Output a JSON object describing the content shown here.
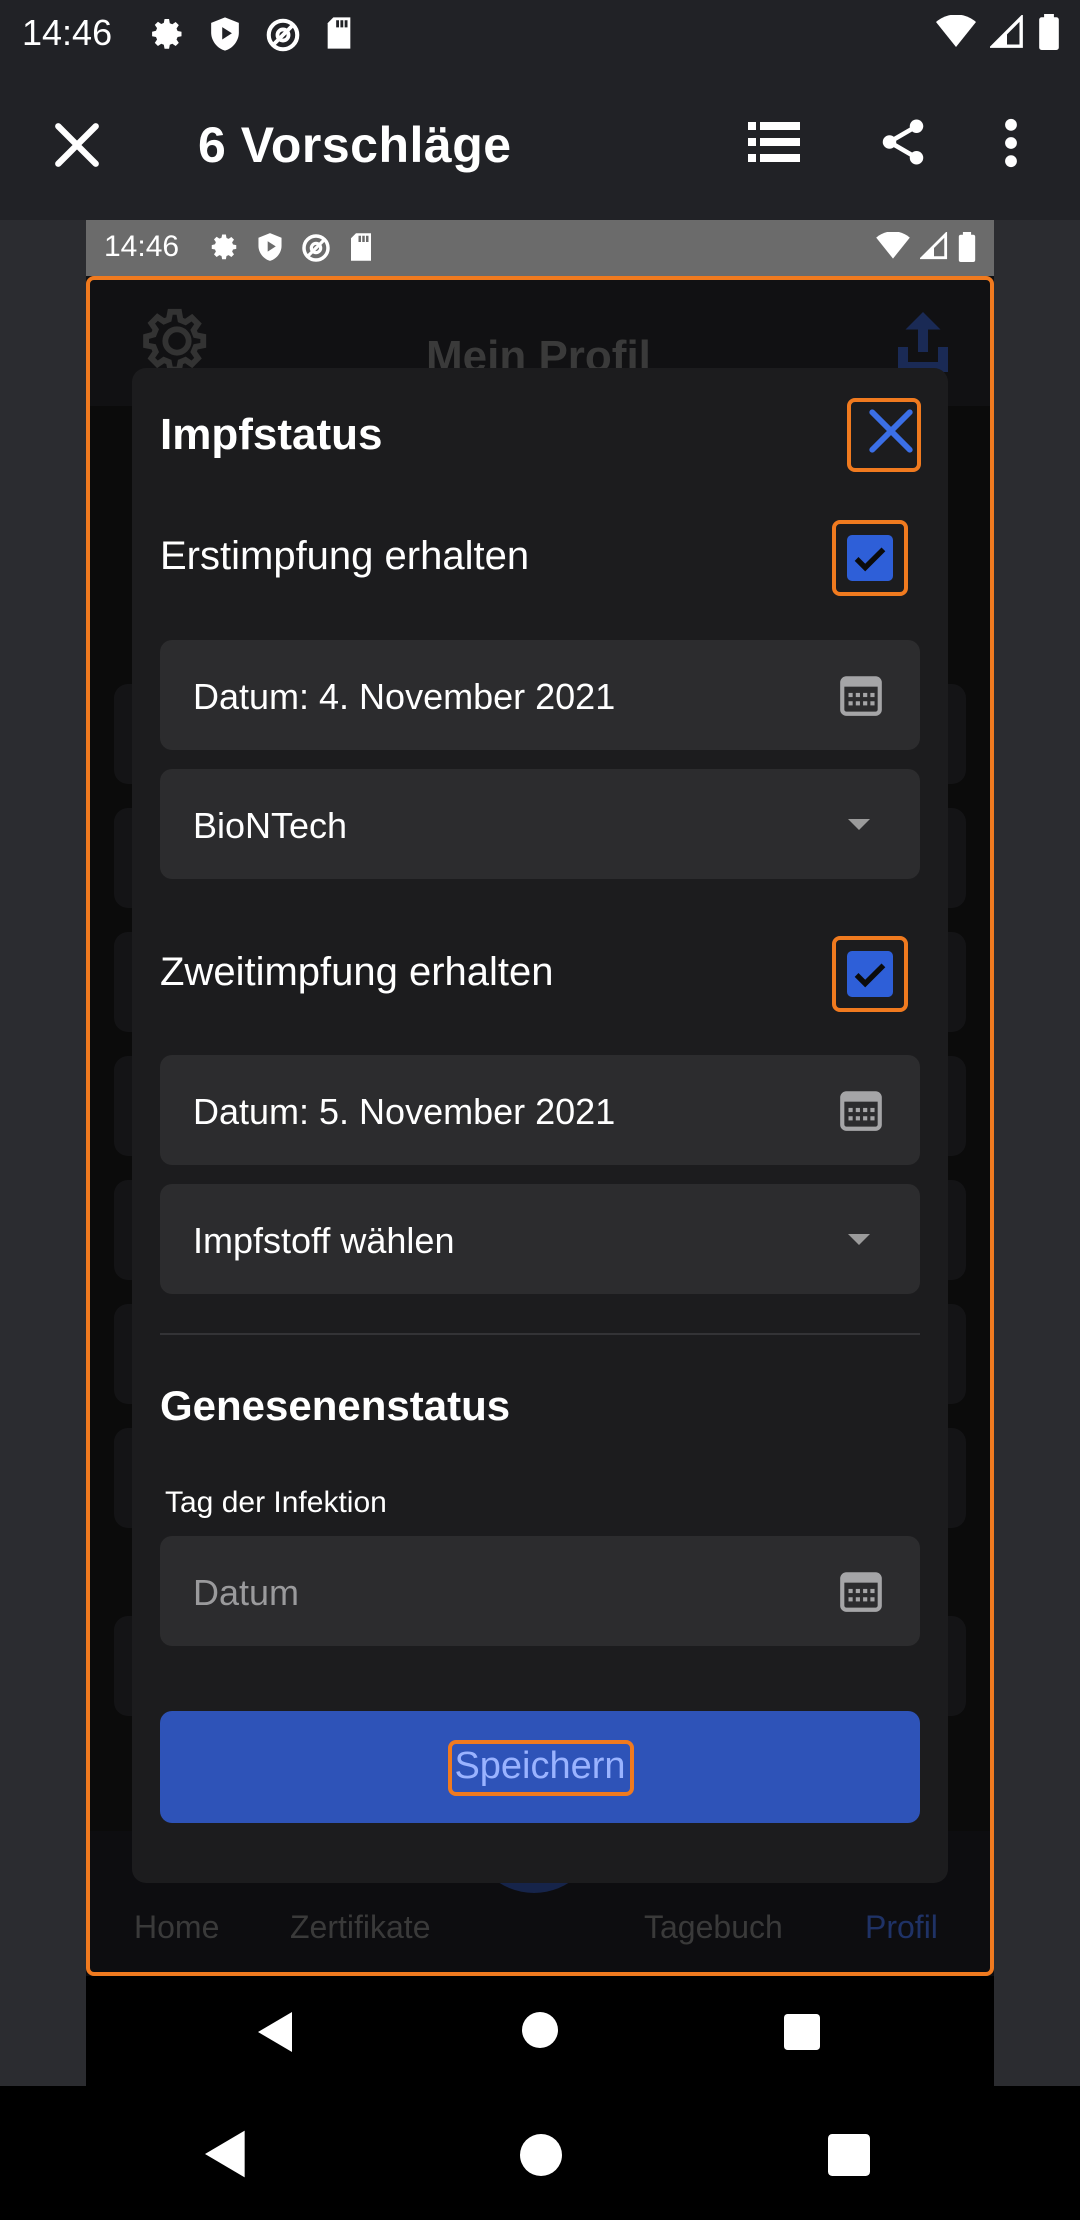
{
  "status_bar": {
    "time": "14:46"
  },
  "app_bar": {
    "title": "6 Vorschläge"
  },
  "preview": {
    "status_time": "14:46",
    "bg_title": "Mein Profil",
    "nav": {
      "home": "Home",
      "zertifikate": "Zertifikate",
      "tagebuch": "Tagebuch",
      "profil": "Profil"
    }
  },
  "modal": {
    "impfstatus_title": "Impfstatus",
    "first": {
      "label": "Erstimpfung erhalten",
      "checked": true,
      "date": "Datum: 4. November 2021",
      "vaccine": "BioNTech"
    },
    "second": {
      "label": "Zweitimpfung erhalten",
      "checked": true,
      "date": "Datum: 5. November 2021",
      "vaccine_placeholder": "Impfstoff wählen"
    },
    "recovered_title": "Genesenenstatus",
    "infection_label": "Tag der Infektion",
    "infection_placeholder": "Datum",
    "save_label": "Speichern"
  },
  "colors": {
    "accent": "#2e5fd8",
    "highlight": "#f07a1f",
    "button": "#2e53b8"
  }
}
